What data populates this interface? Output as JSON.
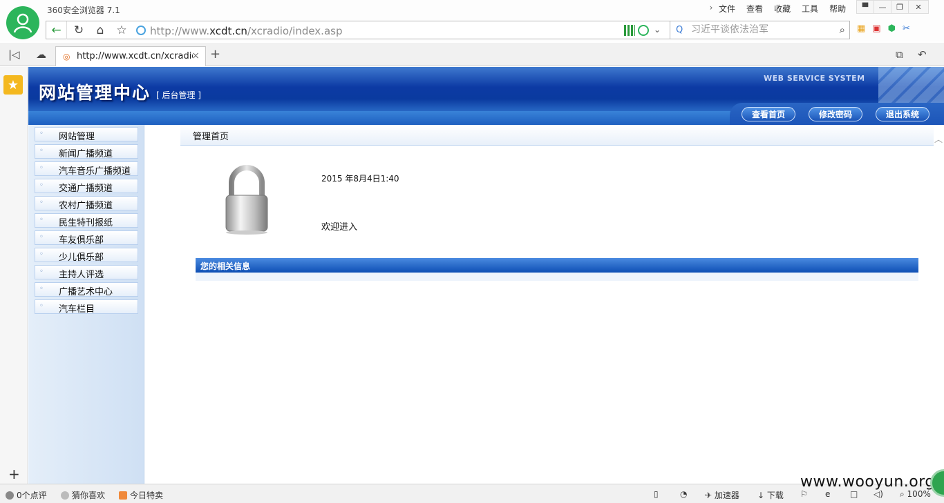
{
  "browser": {
    "title": "360安全浏览器 7.1",
    "menu": [
      "文件",
      "查看",
      "收藏",
      "工具",
      "帮助"
    ],
    "address": {
      "url_prefix": "http://www.",
      "url_domain": "xcdt.cn",
      "url_path": "/xcradio/index.asp"
    },
    "search": {
      "placeholder": "习近平谈依法治军"
    },
    "tab": {
      "title": "http://www.xcdt.cn/xcradio/index.asp"
    }
  },
  "site": {
    "title": "网站管理中心",
    "subtitle": "[ 后台管理 ]",
    "brand_line": "WEB SERVICE SYSTEM",
    "header_buttons": [
      "查看首页",
      "修改密码",
      "退出系统"
    ]
  },
  "leftnav": {
    "items": [
      "网站管理",
      "新闻广播频道",
      "汽车音乐广播频道",
      "交通广播频道",
      "农村广播频道",
      "民生特刊报纸",
      "车友俱乐部",
      "少儿俱乐部",
      "主持人评选",
      "广播艺术中心",
      "汽车栏目"
    ]
  },
  "main": {
    "breadcrumb": "管理首页",
    "datetime": "2015 年8月4日1:40",
    "welcome": "欢迎进入",
    "info_title": "您的相关信息"
  },
  "statusbar": {
    "comments": "0个点评",
    "guess": "猜你喜欢",
    "deals": "今日特卖",
    "accelerator": "加速器",
    "download": "下载",
    "zoom": "100%"
  },
  "watermark": "www.wooyun.org",
  "colors": {
    "header_blue": "#0a3a9f",
    "nav_bg": "#e4eef9",
    "info_bar": "#0e4fb4",
    "browser_accent": "#2cb55b"
  }
}
